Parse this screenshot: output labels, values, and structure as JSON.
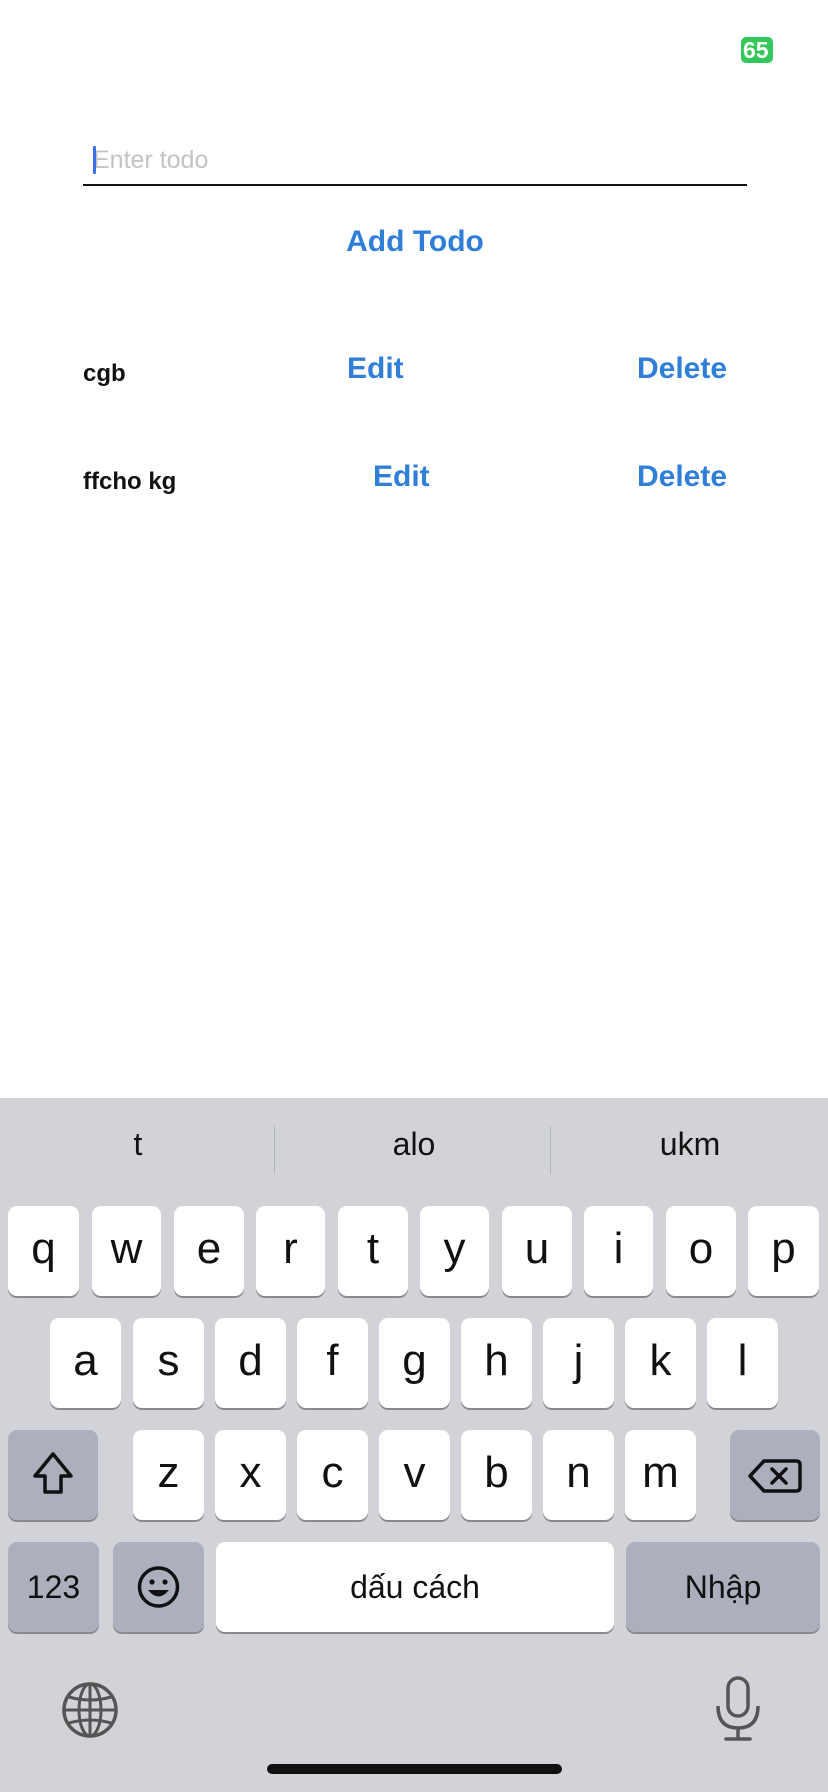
{
  "status_bar": {
    "battery_level": "65",
    "battery_color": "#34c759"
  },
  "form": {
    "input_placeholder": "Enter todo",
    "input_value": "",
    "add_label": "Add Todo"
  },
  "todos": [
    {
      "text": "cgb",
      "edit_label": "Edit",
      "delete_label": "Delete"
    },
    {
      "text": "ffcho kg",
      "edit_label": "Edit",
      "delete_label": "Delete"
    }
  ],
  "keyboard": {
    "suggestions": [
      "t",
      "alo",
      "ukm"
    ],
    "row1": [
      "q",
      "w",
      "e",
      "r",
      "t",
      "y",
      "u",
      "i",
      "o",
      "p"
    ],
    "row2": [
      "a",
      "s",
      "d",
      "f",
      "g",
      "h",
      "j",
      "k",
      "l"
    ],
    "row3": [
      "z",
      "x",
      "c",
      "v",
      "b",
      "n",
      "m"
    ],
    "numbers_label": "123",
    "space_label": "dấu cách",
    "return_label": "Nhập"
  },
  "colors": {
    "accent": "#2f7fd9",
    "keyboard_bg": "#d1d3d9",
    "key_dark": "#abb0bc"
  }
}
